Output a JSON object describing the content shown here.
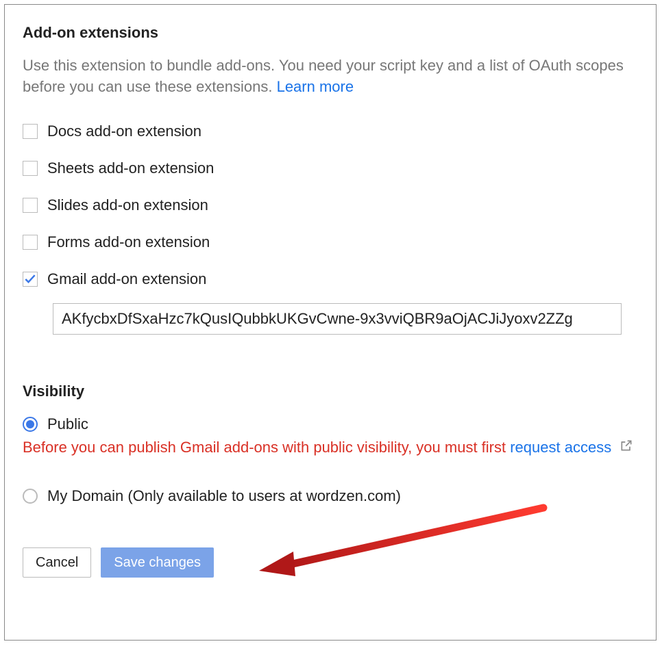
{
  "addons": {
    "title": "Add-on extensions",
    "description_pre": "Use this extension to bundle add-ons. You need your script key and a list of OAuth scopes before you can use these extensions. ",
    "learn_more": "Learn more",
    "items": [
      {
        "label": "Docs add-on extension",
        "checked": false
      },
      {
        "label": "Sheets add-on extension",
        "checked": false
      },
      {
        "label": "Slides add-on extension",
        "checked": false
      },
      {
        "label": "Forms add-on extension",
        "checked": false
      },
      {
        "label": "Gmail add-on extension",
        "checked": true
      }
    ],
    "key_value": "AKfycbxDfSxaHzc7kQusIQubbkUKGvCwne-9x3vviQBR9aOjACJiJyoxv2ZZg"
  },
  "visibility": {
    "title": "Visibility",
    "options": {
      "public": "Public",
      "domain": "My Domain (Only available to users at wordzen.com)"
    },
    "selected": "public",
    "warning_pre": "Before you can publish Gmail add-ons with public visibility, you must first ",
    "warning_link": "request access"
  },
  "buttons": {
    "cancel": "Cancel",
    "save": "Save changes"
  }
}
